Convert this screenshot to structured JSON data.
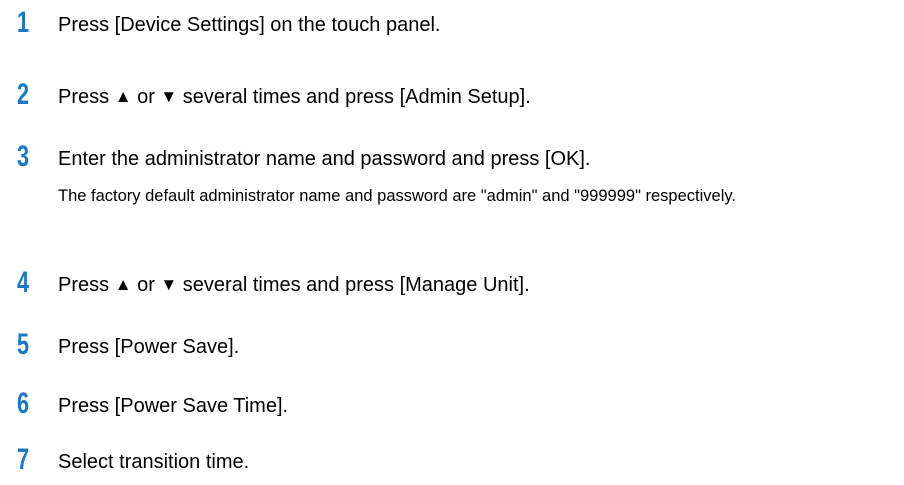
{
  "steps": [
    {
      "number": "1",
      "text": "Press [Device Settings] on the touch panel."
    },
    {
      "number": "2",
      "text_before": "Press ",
      "up_glyph": "▲",
      "text_or": " or ",
      "down_glyph": "▼",
      "text_after": " several times and press [Admin Setup]."
    },
    {
      "number": "3",
      "text": "Enter the administrator name and password and press [OK].",
      "note": "The factory default administrator name and password are \"admin\" and \"999999\" respectively."
    },
    {
      "number": "4",
      "text_before": "Press ",
      "up_glyph": "▲",
      "text_or": " or ",
      "down_glyph": "▼",
      "text_after": " several times and press [Manage Unit]."
    },
    {
      "number": "5",
      "text": "Press [Power Save]."
    },
    {
      "number": "6",
      "text": "Press [Power Save Time]."
    },
    {
      "number": "7",
      "text": "Select transition time."
    }
  ],
  "colors": {
    "step_number": "#1a78c8",
    "text": "#000000",
    "background": "#ffffff"
  },
  "icons": {
    "up": "up-triangle-icon",
    "down": "down-triangle-icon"
  }
}
